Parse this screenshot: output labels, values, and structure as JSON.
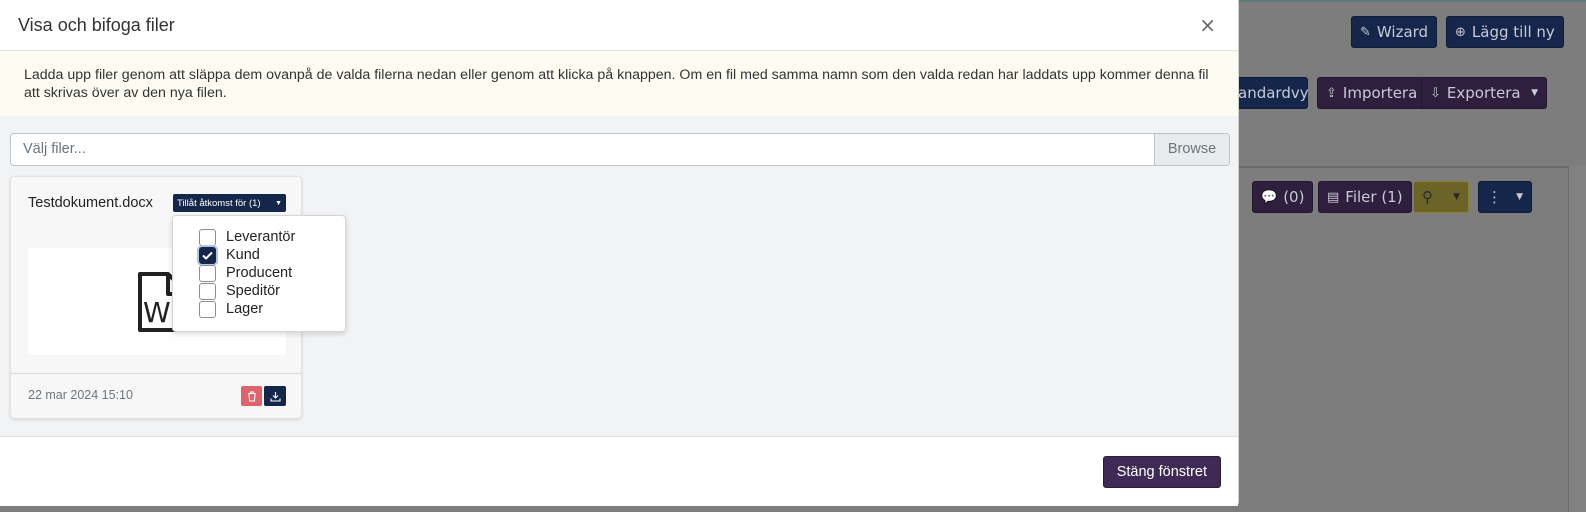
{
  "background": {
    "wizard_label": "Wizard",
    "add_new_label": "Lägg till ny",
    "standard_view_label": "andardvy",
    "import_label": "Importera",
    "export_label": "Exportera",
    "comments_label": "(0)",
    "files_label": "Filer (1)"
  },
  "modal": {
    "title": "Visa och bifoga filer",
    "close_symbol": "×",
    "info_text": "Ladda upp filer genom att släppa dem ovanpå de valda filerna nedan eller genom att klicka på knappen. Om en fil med samma namn som den valda redan har laddats upp kommer denna fil att skrivas över av den nya filen.",
    "file_input": {
      "placeholder": "Välj filer...",
      "browse_label": "Browse"
    },
    "file_card": {
      "file_name": "Testdokument.docx",
      "access_label": "Tillåt åtkomst för (1)",
      "date": "22 mar 2024 15:10"
    },
    "access_options": [
      {
        "label": "Leverantör",
        "checked": false
      },
      {
        "label": "Kund",
        "checked": true
      },
      {
        "label": "Producent",
        "checked": false
      },
      {
        "label": "Speditör",
        "checked": false
      },
      {
        "label": "Lager",
        "checked": false
      }
    ],
    "footer": {
      "close_window_label": "Stäng fönstret"
    }
  },
  "colors": {
    "navy": "#14264a",
    "purple": "#3e2a55",
    "danger": "#e0636b",
    "info_bg": "#fdfcf2"
  }
}
